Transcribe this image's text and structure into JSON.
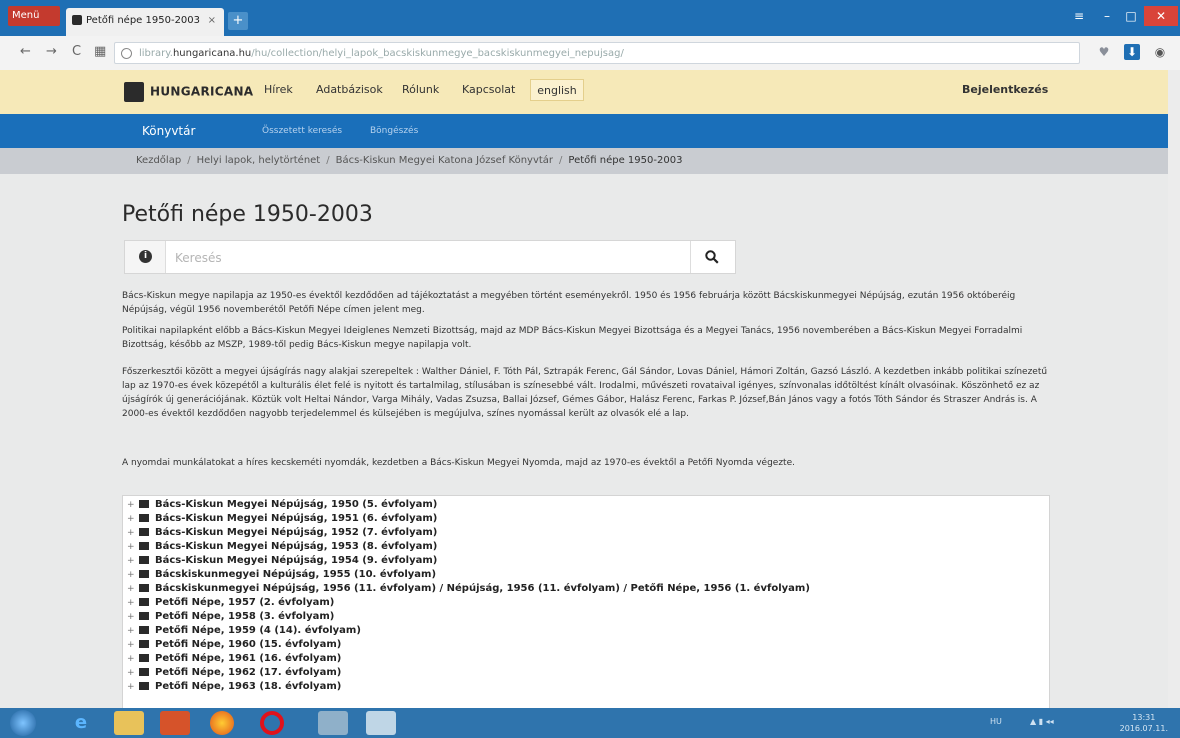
{
  "browser": {
    "menu_label": "Menü",
    "tab_title": "Petőfi népe 1950-2003",
    "tab_close": "×",
    "new_tab": "+",
    "url_prefix": "library.",
    "url_host": "hungaricana.hu",
    "url_path": "/hu/collection/helyi_lapok_bacskiskunmegye_bacskiskunmegyei_nepujsag/"
  },
  "site": {
    "logo": "HUNGARICANA",
    "nav": [
      "Hírek",
      "Adatbázisok",
      "Rólunk",
      "Kapcsolat"
    ],
    "english": "english",
    "login": "Bejelentkezés",
    "section": "Könyvtár",
    "subnav": [
      "Összetett keresés",
      "Böngészés"
    ]
  },
  "breadcrumb": [
    "Kezdőlap",
    "Helyi lapok, helytörténet",
    "Bács-Kiskun Megyei Katona József Könyvtár",
    "Petőfi népe 1950-2003"
  ],
  "page": {
    "title": "Petőfi népe 1950-2003",
    "search_placeholder": "Keresés",
    "paragraphs": [
      "Bács-Kiskun megye napilapja az 1950-es évektől kezdődően ad tájékoztatást a megyében történt eseményekről. 1950 és 1956 februárja között Bácskiskunmegyei Népújság, ezután 1956 októberéig Népújság, végül 1956 novemberétől Petőfi Népe címen jelent meg.",
      "Politikai napilapként előbb a Bács-Kiskun Megyei Ideiglenes Nemzeti Bizottság, majd az MDP Bács-Kiskun Megyei Bizottsága és a Megyei Tanács, 1956 novemberében a Bács-Kiskun Megyei Forradalmi Bizottság, később az MSZP, 1989-től pedig Bács-Kiskun megye napilapja volt.",
      "Főszerkesztői között a megyei újságírás nagy alakjai szerepeltek : Walther Dániel, F. Tóth Pál, Sztrapák Ferenc, Gál Sándor, Lovas Dániel, Hámori Zoltán, Gazsó László. A kezdetben inkább politikai színezetű lap az 1970-es évek közepétől a kulturális élet felé is nyitott és tartalmilag, stílusában is színesebbé vált. Irodalmi, művészeti rovataival igényes, színvonalas időtöltést kínált olvasóinak. Köszönhető ez az újságírók új generációjának. Köztük volt Heltai Nándor, Varga Mihály, Vadas Zsuzsa, Ballai József, Gémes Gábor, Halász Ferenc, Farkas P. József,Bán János vagy a fotós Tóth Sándor és Straszer András is. A 2000-es évektől kezdődően nagyobb terjedelemmel és külsejében is megújulva, színes nyomással került az olvasók elé a lap.",
      "A nyomdai munkálatokat a híres kecskeméti nyomdák, kezdetben a Bács-Kiskun Megyei Nyomda, majd az 1970-es évektől a Petőfi Nyomda végezte."
    ]
  },
  "tree": [
    "Bács-Kiskun Megyei Népújság, 1950 (5. évfolyam)",
    "Bács-Kiskun Megyei Népújság, 1951 (6. évfolyam)",
    "Bács-Kiskun Megyei Népújság, 1952 (7. évfolyam)",
    "Bács-Kiskun Megyei Népújság, 1953 (8. évfolyam)",
    "Bács-Kiskun Megyei Népújság, 1954 (9. évfolyam)",
    "Bácskiskunmegyei Népújság, 1955 (10. évfolyam)",
    "Bácskiskunmegyei Népújság, 1956 (11. évfolyam) / Népújság, 1956 (11. évfolyam) / Petőfi Népe, 1956 (1. évfolyam)",
    "Petőfi Népe, 1957 (2. évfolyam)",
    "Petőfi Népe, 1958 (3. évfolyam)",
    "Petőfi Népe, 1959 (4 (14). évfolyam)",
    "Petőfi Népe, 1960 (15. évfolyam)",
    "Petőfi Népe, 1961 (16. évfolyam)",
    "Petőfi Népe, 1962 (17. évfolyam)",
    "Petőfi Népe, 1963 (18. évfolyam)"
  ],
  "taskbar": {
    "tray_lang": "HU",
    "time": "13:31",
    "date": "2016.07.11."
  },
  "colors": {
    "header_bg": "#f6e9b8",
    "blue_bar": "#1a6fba",
    "breadcrumb_bg": "#c9ccd1"
  }
}
